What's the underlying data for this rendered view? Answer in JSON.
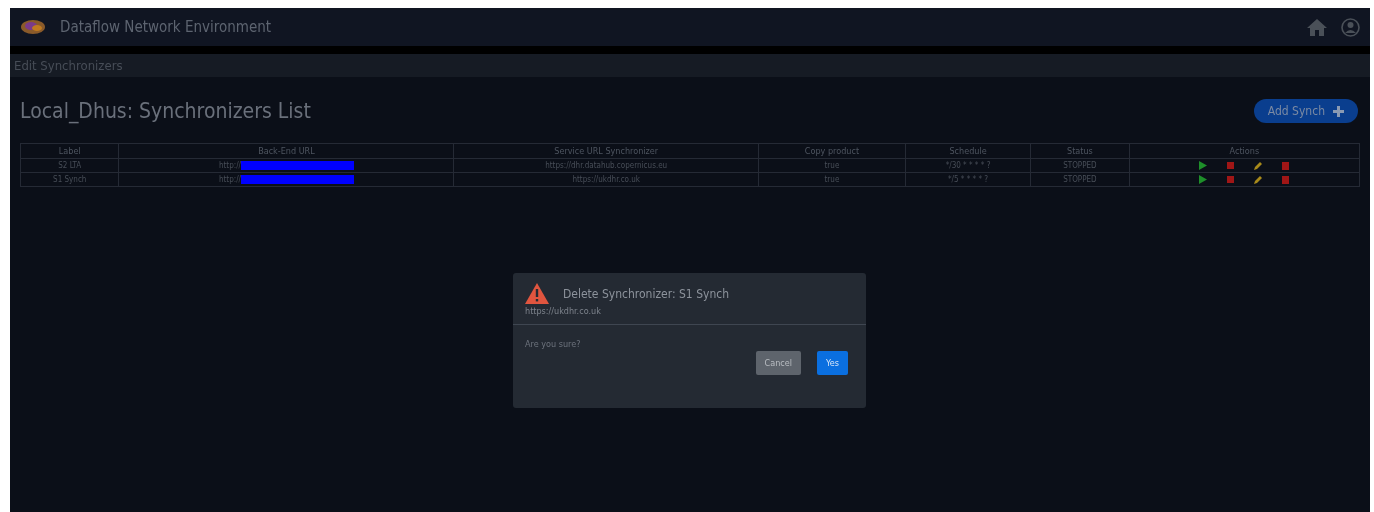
{
  "header": {
    "title": "Dataflow Network Environment"
  },
  "breadcrumb": "Edit Synchronizers",
  "page_title": "Local_Dhus: Synchronizers List",
  "add_button": "Add Synch",
  "table": {
    "columns": [
      "Label",
      "Back-End URL",
      "Service URL Synchronizer",
      "Copy product",
      "Schedule",
      "Status",
      "Actions"
    ],
    "rows": [
      {
        "label": "S2 LTA",
        "backend_url": "http://",
        "service_url": "https://dhr.datahub.copernicus.eu",
        "copy_product": "true",
        "schedule": "*/30 * * * * ?",
        "status": "STOPPED"
      },
      {
        "label": "S1 Synch",
        "backend_url": "http://",
        "service_url": "https://ukdhr.co.uk",
        "copy_product": "true",
        "schedule": "*/5 * * * * ?",
        "status": "STOPPED"
      }
    ]
  },
  "dialog": {
    "title": "Delete Synchronizer: S1 Synch",
    "subtitle": "https://ukdhr.co.uk",
    "message": "Are you sure?",
    "buttons": [
      {
        "label": "Cancel",
        "kind": "secondary"
      },
      {
        "label": "Yes",
        "kind": "primary"
      }
    ]
  }
}
